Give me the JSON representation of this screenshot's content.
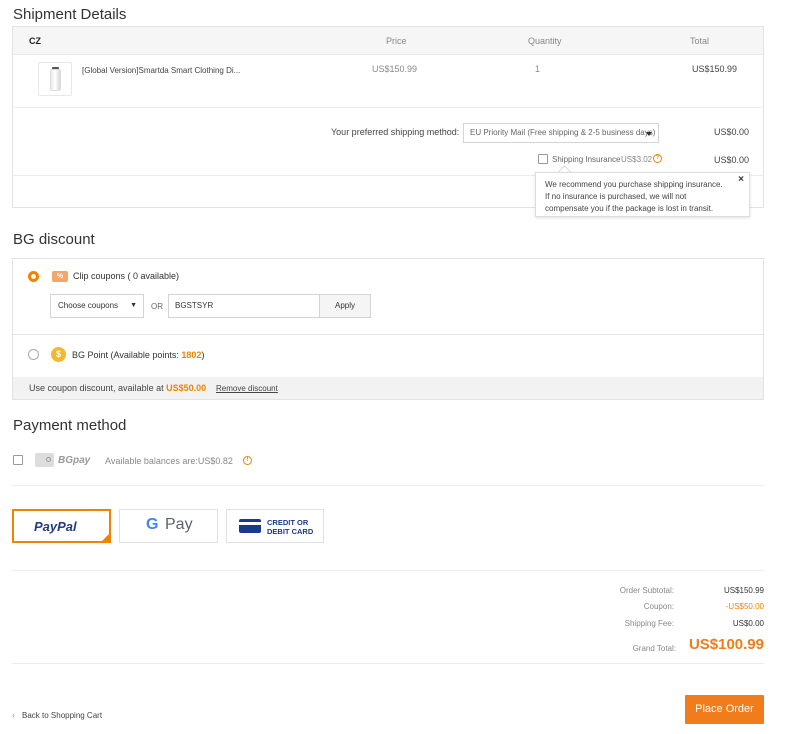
{
  "shipment": {
    "title": "Shipment Details",
    "warehouse": "CZ",
    "columns": {
      "price": "Price",
      "quantity": "Quantity",
      "total": "Total"
    },
    "item": {
      "name": "[Global Version]Smartda Smart Clothing Di...",
      "price": "US$150.99",
      "quantity": "1",
      "total": "US$150.99"
    },
    "shipping_method_label": "Your preferred shipping method:",
    "shipping_method_value": "EU Priority Mail (Free shipping & 2-5 business days)",
    "shipping_cost": "US$0.00",
    "insurance_label": "Shipping Insurance",
    "insurance_price": "US$3.02",
    "insurance_cost": "US$0.00",
    "tooltip_text": "We recommend you purchase shipping insurance. If no insurance is purchased, we will not compensate you if the package is lost in transit.",
    "tooltip_close": "×"
  },
  "discount": {
    "title": "BG discount",
    "coupon_icon_text": "%",
    "clip_coupons_label": "Clip coupons ( 0 available)",
    "choose_coupons": "Choose coupons",
    "or": "OR",
    "coupon_code": "BGSTSYR",
    "apply": "Apply",
    "point_icon_text": "$",
    "bg_point_label": "BG Point (Available points: ",
    "bg_point_value": "1802",
    "bg_point_suffix": ")",
    "footer_text": "Use coupon discount, available at ",
    "footer_amount": "US$50.00",
    "remove_discount": "Remove discount"
  },
  "payment": {
    "title": "Payment method",
    "bgpay_label": "BGpay",
    "bgpay_balance": "Available balances are:US$0.82",
    "paypal": "PayPal",
    "gpay": "Pay",
    "card": "CREDIT OR DEBIT CARD",
    "card_line1": "CREDIT OR",
    "card_line2": "DEBIT CARD"
  },
  "summary": {
    "subtotal_label": "Order Subtotal:",
    "subtotal": "US$150.99",
    "coupon_label": "Coupon:",
    "coupon": "-US$50.00",
    "shipping_label": "Shipping Fee:",
    "shipping": "US$0.00",
    "grand_label": "Grand Total:",
    "grand": "US$100.99"
  },
  "footer": {
    "back": "Back to Shopping Cart",
    "place_order": "Place Order"
  },
  "colors": {
    "accent": "#f08300",
    "place_order": "#f07c1b",
    "paypal_dark": "#253b80",
    "paypal_light": "#179bd7"
  }
}
